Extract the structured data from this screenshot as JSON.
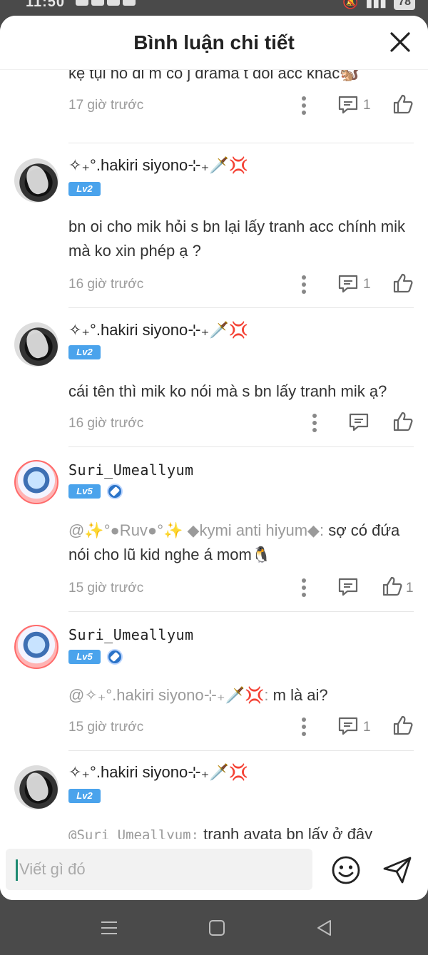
{
  "status_bar": {
    "time": "11:50",
    "battery": "78"
  },
  "header": {
    "title": "Bình luận chi tiết"
  },
  "top_partial": {
    "text": "kệ tụi nó đi m có j drama t đổi acc khác🐿️",
    "time": "17 giờ trước",
    "reply_count": "1"
  },
  "comments": [
    {
      "user": "✧₊°.hakiri siyono⊹₊🗡️💢",
      "level": "Lv2",
      "text": "bn oi cho mik hỏi s bn lại lấy tranh acc chính mik mà ko xin phép ạ ?",
      "time": "16 giờ trước",
      "reply_count": "1"
    },
    {
      "user": "✧₊°.hakiri siyono⊹₊🗡️💢",
      "level": "Lv2",
      "text": "cái tên thì mik ko nói mà s bn lấy tranh mik ạ?",
      "time": "16 giờ trước"
    },
    {
      "user": "Suri_Umeallyum",
      "level": "Lv5",
      "mention": "@✨°●Ruv●°✨ ◆kymi anti hiyum◆:",
      "text": " sợ có đứa nói cho lũ kid nghe á mom🐧",
      "time": "15 giờ trước",
      "like_count": "1"
    },
    {
      "user": "Suri_Umeallyum",
      "level": "Lv5",
      "mention": "@✧₊°.hakiri siyono⊹₊🗡️💢:",
      "text": " m là ai?",
      "time": "15 giờ trước",
      "reply_count": "1"
    },
    {
      "user": "✧₊°.hakiri siyono⊹₊🗡️💢",
      "level": "Lv2",
      "mention": "@Suri_Umeallyum:",
      "text": " tranh avata bn lấy ở đây"
    }
  ],
  "input": {
    "placeholder": "Viết gì đó"
  },
  "icons": {
    "close": "close-icon",
    "more": "more-vertical-icon",
    "reply": "comment-icon",
    "like": "thumbs-up-icon",
    "emoji": "smile-icon",
    "send": "send-icon"
  },
  "colors": {
    "accent": "#4aa3ec",
    "caret": "#1e8a72"
  }
}
